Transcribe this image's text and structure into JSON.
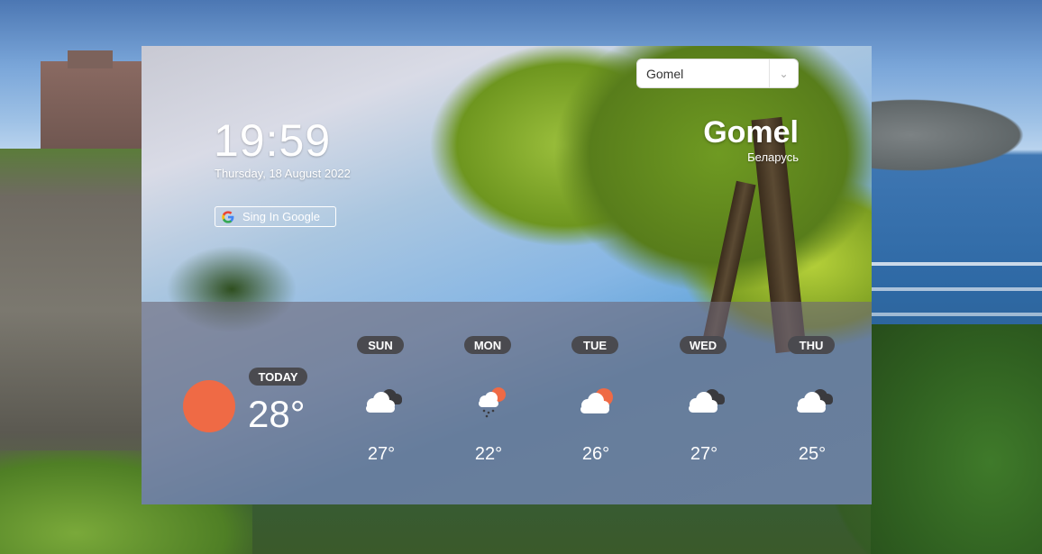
{
  "header": {
    "time": "19:59",
    "date": "Thursday, 18 August 2022",
    "google_button_label": "Sing In Google"
  },
  "location": {
    "selected_city": "Gomel",
    "city_title": "Gomel",
    "country": "Беларусь"
  },
  "today": {
    "label": "TODAY",
    "temperature": "28°",
    "icon": "sun-icon",
    "sun_color": "#ef6a45"
  },
  "forecast": [
    {
      "day": "SUN",
      "temperature": "27°",
      "icon": "cloudy-icon"
    },
    {
      "day": "MON",
      "temperature": "22°",
      "icon": "rain-sun-icon"
    },
    {
      "day": "TUE",
      "temperature": "26°",
      "icon": "partly-sunny-icon"
    },
    {
      "day": "WED",
      "temperature": "27°",
      "icon": "cloudy-icon"
    },
    {
      "day": "THU",
      "temperature": "25°",
      "icon": "cloudy-icon"
    }
  ],
  "colors": {
    "badge_bg": "#4a4a4f",
    "accent_sun": "#ef6a45",
    "panel_overlay": "rgba(110,104,120,0.62)"
  }
}
